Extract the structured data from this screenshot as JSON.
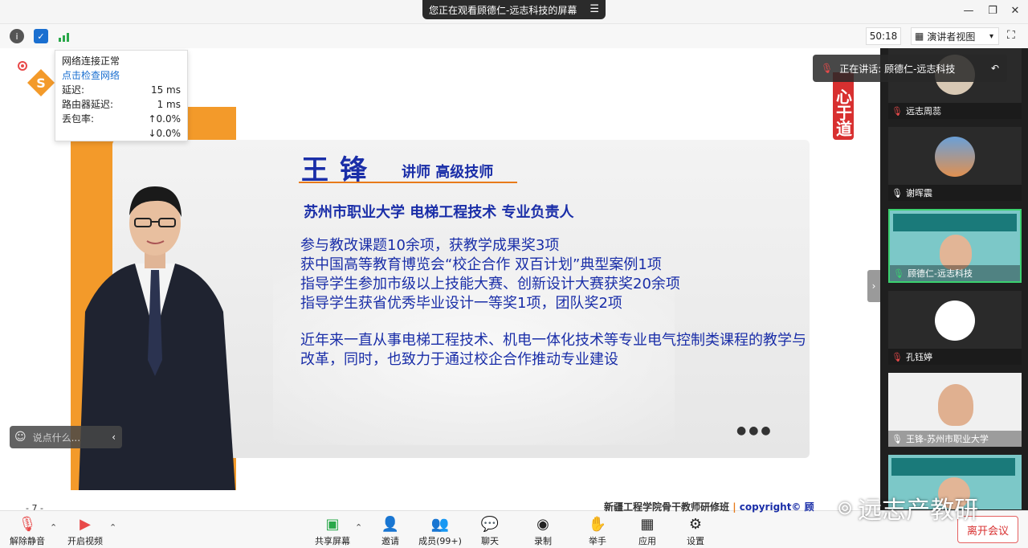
{
  "banner": {
    "text": "您正在观看顾德仁-远志科技的屏幕",
    "menu": "☰"
  },
  "window": {
    "minimize": "—",
    "restore": "❐",
    "close": "✕"
  },
  "toolbar": {
    "timer": "50:18",
    "view_label": "演讲者视图",
    "view_caret": "▾",
    "fullscreen": "⛶"
  },
  "network": {
    "title": "网络连接正常",
    "link": "点击检查网络",
    "rows": [
      {
        "label": "延迟:",
        "value": "15 ms"
      },
      {
        "label": "路由器延迟:",
        "value": "1 ms"
      },
      {
        "label": "丢包率:",
        "value": "↑0.0%"
      },
      {
        "label": "",
        "value": "↓0.0%"
      }
    ]
  },
  "slide": {
    "name": "王锋",
    "titles": "讲师 高级技师",
    "org": "苏州市职业大学  电梯工程技术  专业负责人",
    "achievements": [
      "参与教改课题10余项，获教学成果奖3项",
      "获中国高等教育博览会“校企合作 双百计划”典型案例1项",
      "指导学生参加市级以上技能大赛、创新设计大赛获奖20余项",
      "指导学生获省优秀毕业设计一等奖1项，团队奖2项"
    ],
    "description": "近年来一直从事电梯工程技术、机电一体化技术等专业电气控制类课程的教学与改革，同时，也致力于通过校企合作推动专业建设",
    "red_tag": "心于道",
    "footer": "新疆工程学院骨干教师研修班",
    "footer_copy": "copyright© 顾",
    "page": "- 7 -",
    "dots": "●●●"
  },
  "speaking": {
    "text": "正在讲话: 顾德仁-远志科技"
  },
  "comment": {
    "placeholder": "说点什么..."
  },
  "participants": [
    {
      "name": "远志周蕊",
      "mic": "muted"
    },
    {
      "name": "谢晖震",
      "mic": "on"
    },
    {
      "name": "顾德仁-远志科技",
      "mic": "active"
    },
    {
      "name": "孔钰婷",
      "mic": "muted"
    },
    {
      "name": "王锋-苏州市职业大学",
      "mic": "on"
    },
    {
      "name": "",
      "mic": "on"
    }
  ],
  "bottom": {
    "mute": "解除静音",
    "video": "开启视频",
    "share": "共享屏幕",
    "invite": "邀请",
    "members": "成员(99+)",
    "chat": "聊天",
    "record": "录制",
    "hand": "举手",
    "apps": "应用",
    "settings": "设置",
    "leave": "离开会议"
  },
  "watermark": "远志产教研",
  "colors": {
    "accent": "#1a2ea8",
    "orange": "#f39a2a",
    "danger": "#d83030"
  }
}
